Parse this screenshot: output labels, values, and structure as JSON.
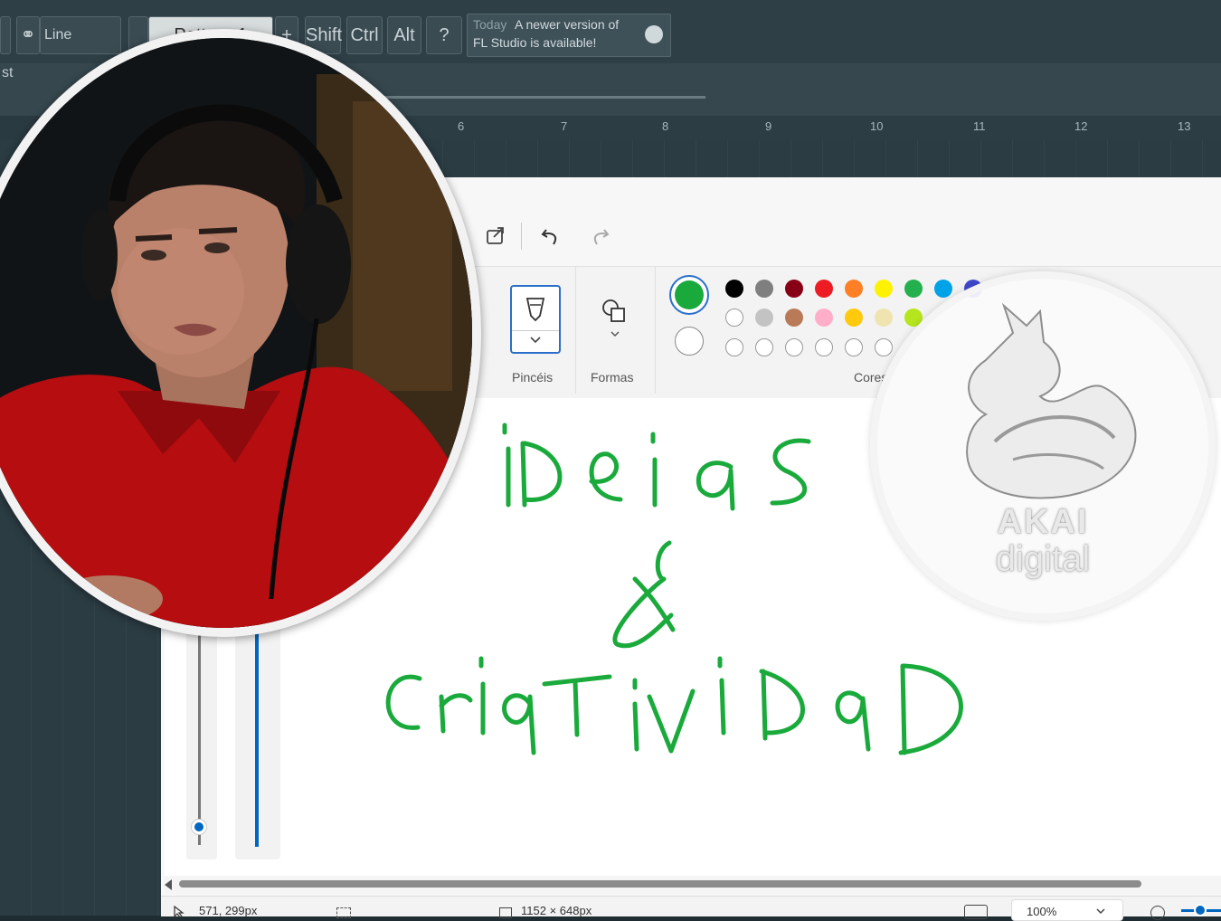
{
  "fl_studio": {
    "line_mode": "Line",
    "pattern_label": "Pattern 1",
    "plus_label": "+",
    "modifier_keys": [
      "Shift",
      "Ctrl",
      "Alt"
    ],
    "notification_prefix": "Today",
    "notification_line1": "A newer version of",
    "notification_line2": "FL Studio is available!",
    "side_label": "st",
    "ruler_ticks": [
      "6",
      "7",
      "8",
      "9",
      "10",
      "11",
      "12",
      "13"
    ]
  },
  "paint": {
    "brushes_label": "Pincéis",
    "shapes_label": "Formas",
    "colors_label": "Cores",
    "selected_color": "#1aaa3c",
    "secondary_color": "#ffffff",
    "palette_row1": [
      "#000000",
      "#7f7f7f",
      "#880015",
      "#ed1c24",
      "#ff7f27",
      "#fff200",
      "#22b14c",
      "#00a2e8",
      "#3f48cc"
    ],
    "palette_row2": [
      "#ffffff",
      "#c3c3c3",
      "#b97a57",
      "#ffaec9",
      "#ffc90e",
      "#efe4b0",
      "#b5e61d"
    ],
    "canvas_text": {
      "line1": "iDeias",
      "line2": "&",
      "line3": "criaTiviDaD"
    },
    "ink_color": "#1aaa3c",
    "status": {
      "cursor_pos": "571, 299px",
      "canvas_size": "1152 × 648px",
      "zoom": "100%"
    }
  },
  "logo": {
    "brand": "AKAI",
    "sub": "digital"
  }
}
